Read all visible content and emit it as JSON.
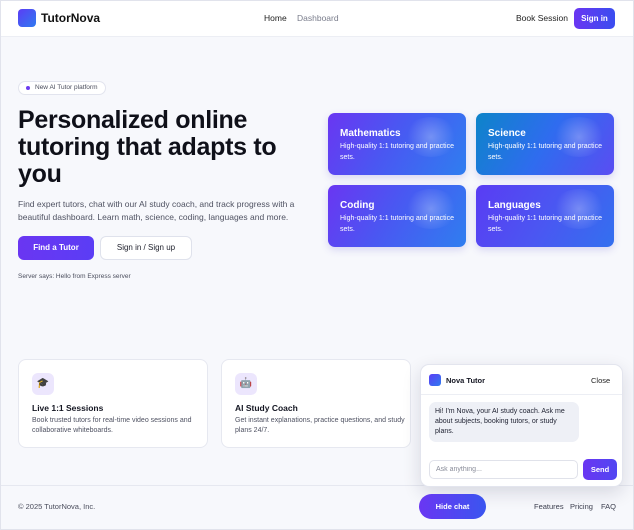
{
  "header": {
    "brand": "TutorNova",
    "nav": {
      "home": "Home",
      "dashboard": "Dashboard"
    },
    "book_session": "Book Session",
    "sign_in": "Sign in"
  },
  "hero": {
    "badge": "New AI Tutor platform",
    "title": "Personalized online tutoring that adapts to you",
    "subtitle": "Find expert tutors, chat with our AI study coach, and track progress with a beautiful dashboard. Learn math, science, coding, languages and more.",
    "primary_cta": "Find a Tutor",
    "secondary_cta": "Sign in / Sign up",
    "server_message": "Server says: Hello from Express server"
  },
  "subjects": [
    {
      "title": "Mathematics",
      "desc": "High-quality 1:1 tutoring and practice sets."
    },
    {
      "title": "Science",
      "desc": "High-quality 1:1 tutoring and practice sets."
    },
    {
      "title": "Coding",
      "desc": "High-quality 1:1 tutoring and practice sets."
    },
    {
      "title": "Languages",
      "desc": "High-quality 1:1 tutoring and practice sets."
    }
  ],
  "features": [
    {
      "icon": "🎓",
      "title": "Live 1:1 Sessions",
      "desc": "Book trusted tutors for real-time video sessions and collaborative whiteboards."
    },
    {
      "icon": "🤖",
      "title": "AI Study Coach",
      "desc": "Get instant explanations, practice questions, and study plans 24/7."
    }
  ],
  "footer": {
    "copyright": "© 2025 TutorNova, Inc.",
    "links": {
      "features": "Features",
      "pricing": "Pricing",
      "faq": "FAQ"
    }
  },
  "chat": {
    "title": "Nova Tutor",
    "close": "Close",
    "greeting": "Hi! I'm Nova, your AI study coach. Ask me about subjects, booking tutors, or study plans.",
    "input_placeholder": "Ask anything...",
    "send": "Send",
    "hide": "Hide chat"
  },
  "colors": {
    "accent": "#6a36f2",
    "accent_blue": "#2f7bf0",
    "background": "#f7f8fc"
  }
}
